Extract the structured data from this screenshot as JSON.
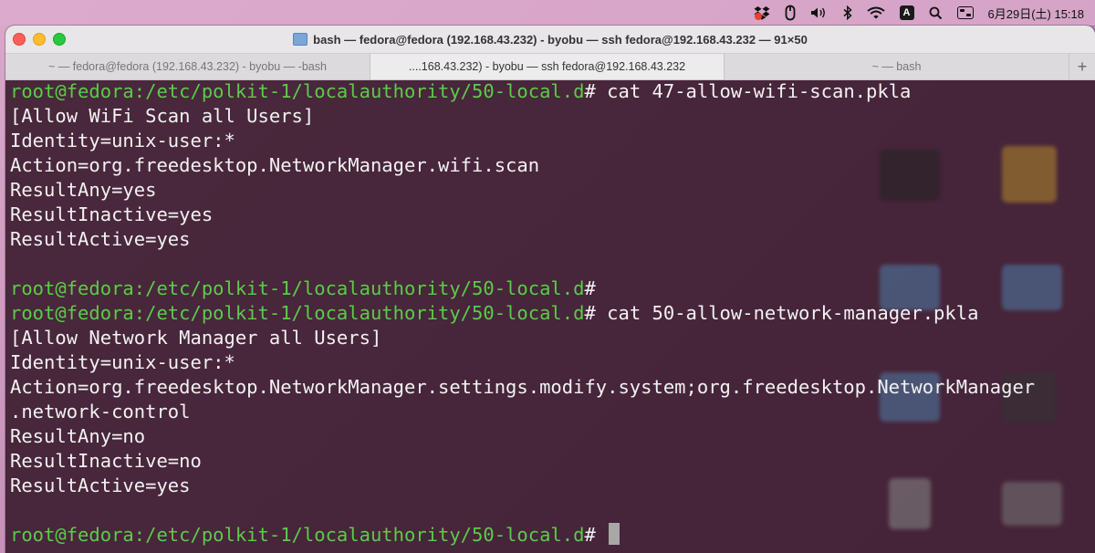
{
  "menubar": {
    "icons": [
      "dropbox-icon",
      "mouse-icon",
      "volume-icon",
      "bluetooth-icon",
      "wifi-icon",
      "input-source-icon",
      "search-icon",
      "control-center-icon"
    ],
    "input_source_label": "A",
    "clock": "6月29日(土)  15:18"
  },
  "window": {
    "title": "bash — fedora@fedora (192.168.43.232) - byobu — ssh fedora@192.168.43.232 — 91×50",
    "tabs": [
      {
        "label": "~ — fedora@fedora (192.168.43.232) - byobu — -bash",
        "active": false
      },
      {
        "label": "....168.43.232) - byobu — ssh fedora@192.168.43.232",
        "active": true
      },
      {
        "label": "~ — bash",
        "active": false
      }
    ],
    "add_tab_label": "+"
  },
  "terminal": {
    "prompt_user": "root@fedora",
    "prompt_path": ":/etc/polkit-1/localauthority/50-local.d",
    "prompt_symbol": "#",
    "cmd1": " cat 47-allow-wifi-scan.pkla",
    "out1": [
      "[Allow WiFi Scan all Users]",
      "Identity=unix-user:*",
      "Action=org.freedesktop.NetworkManager.wifi.scan",
      "ResultAny=yes",
      "ResultInactive=yes",
      "ResultActive=yes"
    ],
    "cmd2": " cat 50-allow-network-manager.pkla",
    "out2": [
      "[Allow Network Manager all Users]",
      "Identity=unix-user:*",
      "Action=org.freedesktop.NetworkManager.settings.modify.system;org.freedesktop.NetworkManager",
      ".network-control",
      "ResultAny=no",
      "ResultInactive=no",
      "ResultActive=yes"
    ]
  },
  "colors": {
    "prompt": "#5ccb4a",
    "text": "#f2f2f2",
    "terminal_bg": "#3e1e32"
  }
}
